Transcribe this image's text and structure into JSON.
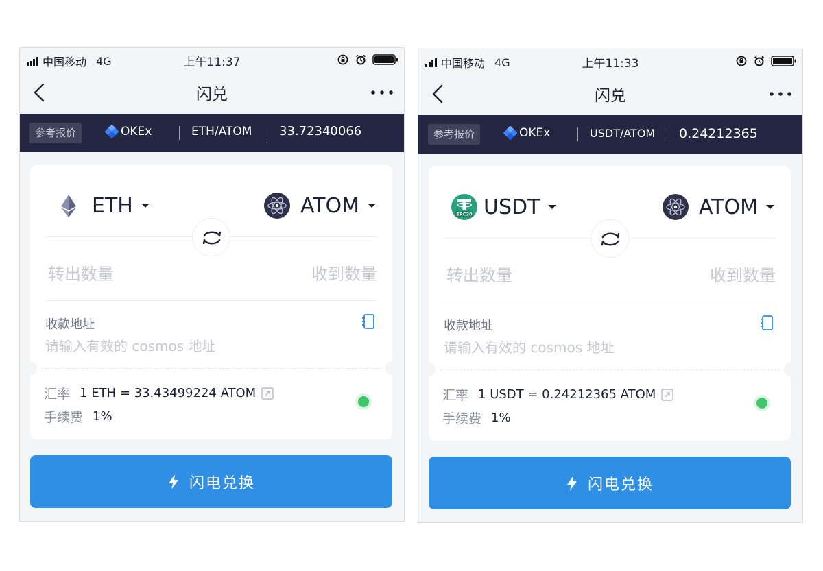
{
  "screens": [
    {
      "status": {
        "carrier": "中国移动",
        "network": "4G",
        "time": "上午11:37"
      },
      "nav": {
        "title": "闪兑"
      },
      "quote": {
        "ref_label": "参考报价",
        "exchange": "OKEx",
        "pair": "ETH/ATOM",
        "price": "33.72340066"
      },
      "from_coin": {
        "name": "ETH",
        "icon": "ethereum-icon"
      },
      "to_coin": {
        "name": "ATOM",
        "icon": "cosmos-atom-icon"
      },
      "amount": {
        "from_placeholder": "转出数量",
        "to_placeholder": "收到数量"
      },
      "address": {
        "label": "收款地址",
        "placeholder": "请输入有效的 cosmos 地址"
      },
      "rate": {
        "label": "汇率",
        "value": "1 ETH = 33.43499224 ATOM"
      },
      "fee": {
        "label": "手续费",
        "value": "1%"
      },
      "button": {
        "label": "闪电兑换"
      }
    },
    {
      "status": {
        "carrier": "中国移动",
        "network": "4G",
        "time": "上午11:33"
      },
      "nav": {
        "title": "闪兑"
      },
      "quote": {
        "ref_label": "参考报价",
        "exchange": "OKEx",
        "pair": "USDT/ATOM",
        "price": "0.24212365"
      },
      "from_coin": {
        "name": "USDT",
        "icon": "tether-usdt-icon",
        "badge": "ERC20"
      },
      "to_coin": {
        "name": "ATOM",
        "icon": "cosmos-atom-icon"
      },
      "amount": {
        "from_placeholder": "转出数量",
        "to_placeholder": "收到数量"
      },
      "address": {
        "label": "收款地址",
        "placeholder": "请输入有效的 cosmos 地址"
      },
      "rate": {
        "label": "汇率",
        "value": "1 USDT = 0.24212365 ATOM"
      },
      "fee": {
        "label": "手续费",
        "value": "1%"
      },
      "button": {
        "label": "闪电兑换"
      }
    }
  ],
  "colors": {
    "quote_bar": "#232741",
    "primary_button": "#2f8fe5",
    "status_online": "#3fc66a",
    "tether_green": "#26a17b",
    "atom_dark": "#2e3148"
  }
}
